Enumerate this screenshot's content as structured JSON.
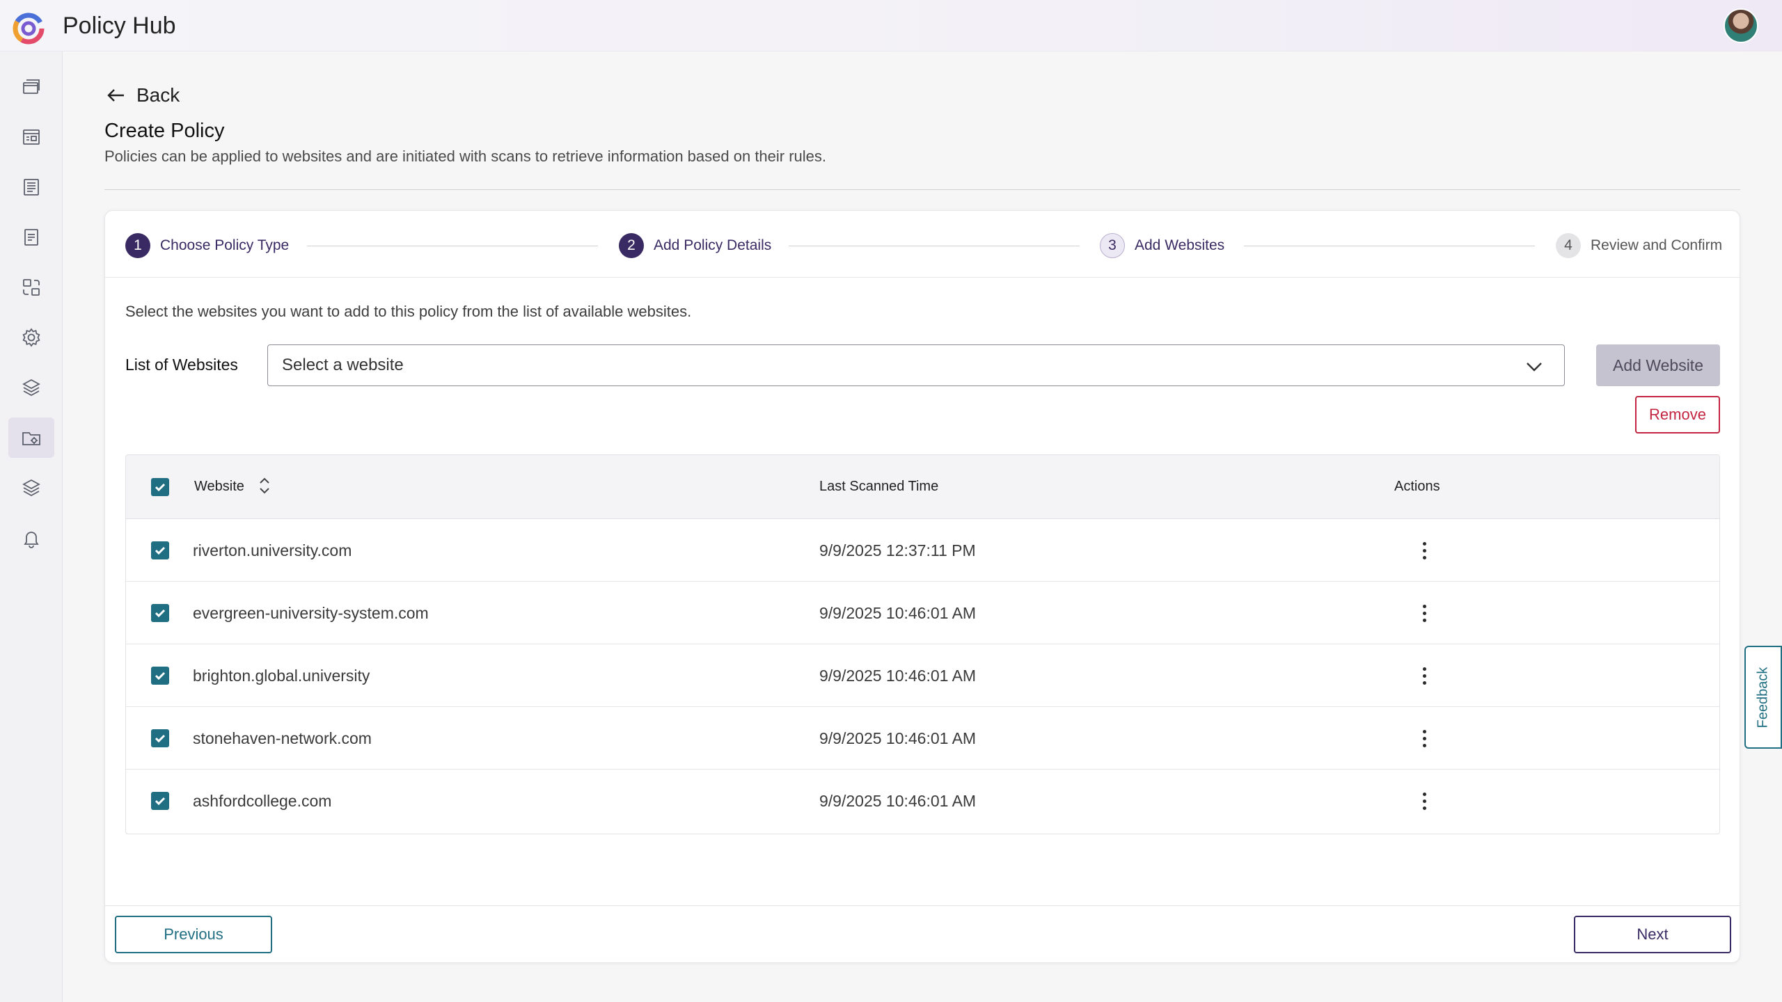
{
  "app": {
    "title": "Policy Hub"
  },
  "sidebar": {
    "items": [
      {
        "icon": "stacked-windows-icon"
      },
      {
        "icon": "dashboard-icon"
      },
      {
        "icon": "report-icon"
      },
      {
        "icon": "document-icon"
      },
      {
        "icon": "scan-icon"
      },
      {
        "icon": "gear-icon"
      },
      {
        "icon": "layers-icon"
      },
      {
        "icon": "policy-folder-icon",
        "active": true
      },
      {
        "icon": "layers-icon"
      },
      {
        "icon": "bell-icon"
      }
    ]
  },
  "header": {
    "back_label": "Back",
    "title": "Create Policy",
    "description": "Policies can be applied to websites and are initiated with scans to retrieve information based on their rules."
  },
  "stepper": {
    "steps": [
      {
        "num": "1",
        "label": "Choose Policy Type",
        "state": "done"
      },
      {
        "num": "2",
        "label": "Add Policy Details",
        "state": "done"
      },
      {
        "num": "3",
        "label": "Add Websites",
        "state": "current"
      },
      {
        "num": "4",
        "label": "Review and Confirm",
        "state": "todo"
      }
    ]
  },
  "form": {
    "instruction": "Select the websites you want to add to this policy from the list of available websites.",
    "list_label": "List of Websites",
    "select_placeholder": "Select a website",
    "add_button": "Add Website",
    "remove_button": "Remove"
  },
  "table": {
    "headers": {
      "website": "Website",
      "last_scanned": "Last Scanned Time",
      "actions": "Actions"
    },
    "rows": [
      {
        "website": "riverton.university.com",
        "last_scanned": "9/9/2025 12:37:11 PM",
        "checked": true
      },
      {
        "website": "evergreen-university-system.com",
        "last_scanned": "9/9/2025 10:46:01 AM",
        "checked": true
      },
      {
        "website": "brighton.global.university",
        "last_scanned": "9/9/2025 10:46:01 AM",
        "checked": true
      },
      {
        "website": "stonehaven-network.com",
        "last_scanned": "9/9/2025 10:46:01 AM",
        "checked": true
      },
      {
        "website": "ashfordcollege.com",
        "last_scanned": "9/9/2025 10:46:01 AM",
        "checked": true
      }
    ]
  },
  "footer": {
    "previous": "Previous",
    "next": "Next"
  },
  "feedback": {
    "label": "Feedback"
  },
  "colors": {
    "primary": "#3a2a63",
    "teal": "#1f6e82",
    "danger": "#c3243f"
  }
}
